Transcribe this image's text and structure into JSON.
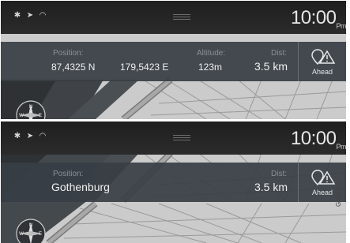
{
  "time": {
    "value": "10:00",
    "suffix": "Pm"
  },
  "status": {
    "bluetooth": "bluetooth-icon",
    "navigation": "location-arrow-icon",
    "wifi": "wifi-icon"
  },
  "panel1": {
    "position_label": "Position:",
    "latitude": "87,4325 N",
    "longitude": "179,5423 E",
    "altitude_label": "Altitude:",
    "altitude": "123m",
    "dist_label": "Dist:",
    "dist": "3.5 km",
    "ahead_label": "Ahead"
  },
  "panel2": {
    "position_label": "Position:",
    "position": "Gothenburg",
    "dist_label": "Dist:",
    "dist": "3.5 km",
    "ahead_label": "Ahead"
  },
  "compass": {
    "n": "N",
    "w": "W",
    "e": "E"
  },
  "image_code": "G053953"
}
